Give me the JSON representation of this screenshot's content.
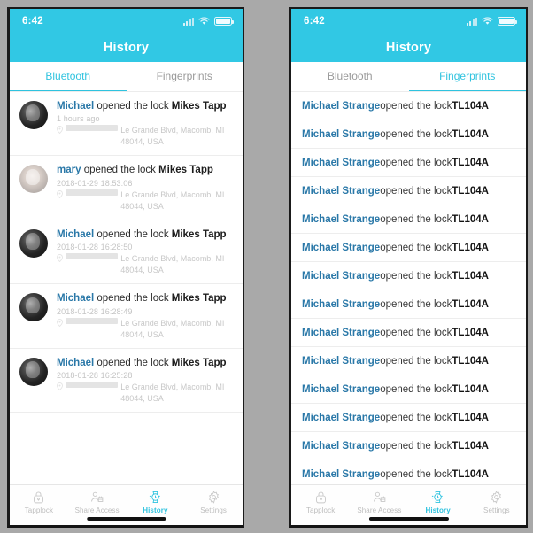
{
  "meta": {
    "accent_cyan": "#31c8e4",
    "link_blue": "#2a78a8",
    "muted_gray": "#c4c4c4",
    "background_gray": "#a9a9a9"
  },
  "statusbar": {
    "time": "6:42",
    "signal_icon": "cellular-signal-icon",
    "wifi_icon": "wifi-icon",
    "battery_icon": "battery-icon"
  },
  "header": {
    "title": "History"
  },
  "left_panel": {
    "tabs": [
      {
        "label": "Bluetooth",
        "active": true
      },
      {
        "label": "Fingerprints",
        "active": false
      }
    ],
    "entries": [
      {
        "user": "Michael",
        "action": " opened the lock ",
        "lock": "Mikes Tapp",
        "time": "1 hours ago",
        "address_suffix": "Le Grande Blvd, Macomb, MI 48044, USA",
        "avatar": "dark"
      },
      {
        "user": "mary",
        "action": " opened the lock ",
        "lock": "Mikes Tapp",
        "time": "2018-01-29 18:53:06",
        "address_suffix": "Le Grande Blvd, Macomb, MI 48044, USA",
        "avatar": "light"
      },
      {
        "user": "Michael",
        "action": " opened the lock ",
        "lock": "Mikes Tapp",
        "time": "2018-01-28 16:28:50",
        "address_suffix": "Le Grande Blvd, Macomb, MI 48044, USA",
        "avatar": "dark"
      },
      {
        "user": "Michael",
        "action": " opened the lock ",
        "lock": "Mikes Tapp",
        "time": "2018-01-28 16:28:49",
        "address_suffix": "Le Grande Blvd, Macomb, MI 48044, USA",
        "avatar": "dark"
      },
      {
        "user": "Michael",
        "action": " opened the lock ",
        "lock": "Mikes Tapp",
        "time": "2018-01-28 16:25:28",
        "address_suffix": "Le Grande Blvd, Macomb, MI 48044, USA",
        "avatar": "dark"
      }
    ]
  },
  "right_panel": {
    "tabs": [
      {
        "label": "Bluetooth",
        "active": false
      },
      {
        "label": "Fingerprints",
        "active": true
      }
    ],
    "entries": [
      {
        "user": "Michael Strange",
        "action": " opened the lock ",
        "lock": "TL104A"
      },
      {
        "user": "Michael Strange",
        "action": " opened the lock ",
        "lock": "TL104A"
      },
      {
        "user": "Michael Strange",
        "action": " opened the lock ",
        "lock": "TL104A"
      },
      {
        "user": "Michael Strange",
        "action": " opened the lock ",
        "lock": "TL104A"
      },
      {
        "user": "Michael Strange",
        "action": " opened the lock ",
        "lock": "TL104A"
      },
      {
        "user": "Michael Strange",
        "action": " opened the lock ",
        "lock": "TL104A"
      },
      {
        "user": "Michael Strange",
        "action": " opened the lock ",
        "lock": "TL104A"
      },
      {
        "user": "Michael Strange",
        "action": " opened the lock ",
        "lock": "TL104A"
      },
      {
        "user": "Michael Strange",
        "action": " opened the lock ",
        "lock": "TL104A"
      },
      {
        "user": "Michael Strange",
        "action": " opened the lock ",
        "lock": "TL104A"
      },
      {
        "user": "Michael Strange",
        "action": " opened the lock ",
        "lock": "TL104A"
      },
      {
        "user": "Michael Strange",
        "action": " opened the lock ",
        "lock": "TL104A"
      },
      {
        "user": "Michael Strange",
        "action": " opened the lock ",
        "lock": "TL104A"
      },
      {
        "user": "Michael Strange",
        "action": " opened the lock ",
        "lock": "TL104A"
      }
    ]
  },
  "tabbar": {
    "items": [
      {
        "label": "Tapplock",
        "icon": "lock-icon",
        "active": false
      },
      {
        "label": "Share Access",
        "icon": "people-icon",
        "active": false
      },
      {
        "label": "History",
        "icon": "watch-icon",
        "active": true
      },
      {
        "label": "Settings",
        "icon": "gear-icon",
        "active": false
      }
    ]
  }
}
